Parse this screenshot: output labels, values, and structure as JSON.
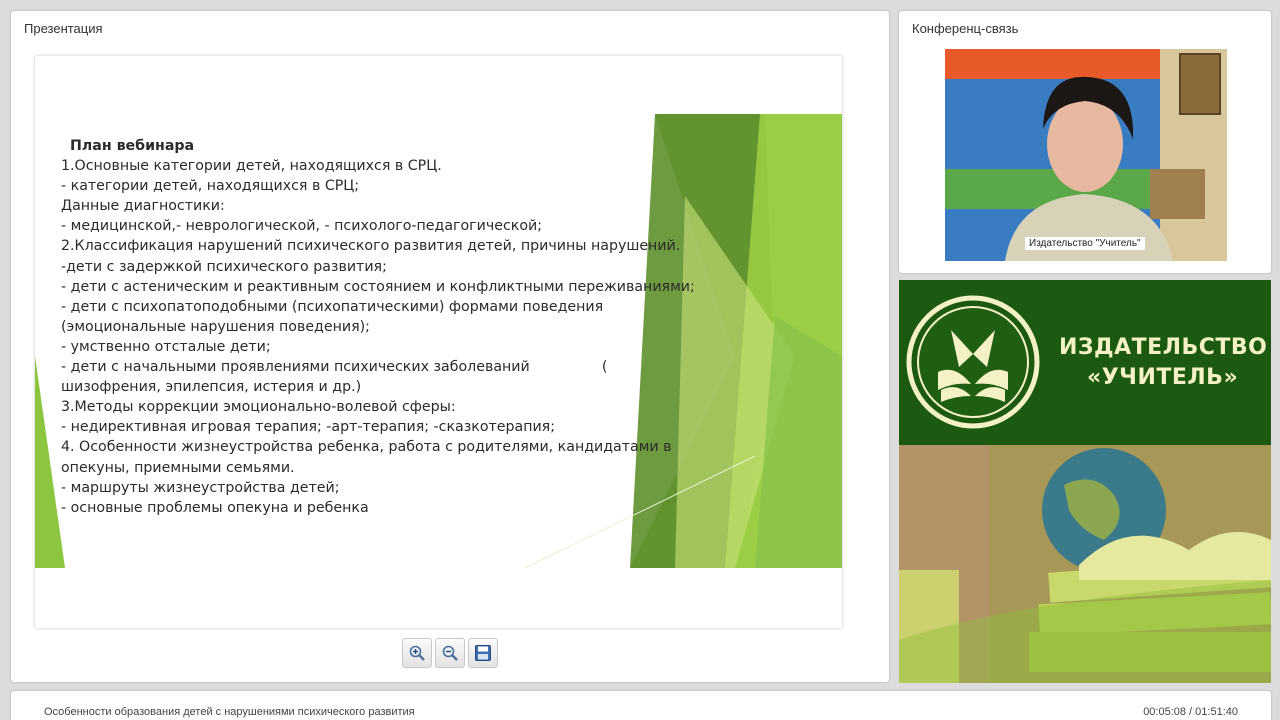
{
  "presentation": {
    "title": "Презентация",
    "slide": {
      "heading": "План вебинара",
      "lines": [
        "1.Основные категории детей, находящихся в СРЦ.",
        "- категории детей, находящихся в СРЦ;",
        "Данные диагностики:",
        "- медицинской,- неврологической, - психолого-педагогической;",
        " 2.Классификация нарушений психического развития детей, причины нарушений.",
        "-дети с задержкой психического развития;",
        "- дети с астеническим и реактивным состоянием и конфликтными переживаниями;",
        "- дети с психопатоподобными (психопатическими) формами поведения",
        "(эмоциональные нарушения поведения);",
        "- умственно отсталые дети;",
        "- дети с начальными проявлениями психических заболеваний                (",
        "шизофрения, эпилепсия, истерия и др.)",
        "3.Методы коррекции эмоционально-волевой сферы:",
        "- недирективная игровая терапия; -арт-терапия; -сказкотерапия;",
        "4. Особенности жизнеустройства ребенка, работа с родителями, кандидатами в",
        "опекуны, приемными семьями.",
        "- маршруты жизнеустройства детей;",
        "- основные проблемы опекуна и ребенка"
      ]
    },
    "toolbar": {
      "zoom_in_icon": "zoom-in-icon",
      "zoom_out_icon": "zoom-out-icon",
      "save_icon": "save-icon"
    }
  },
  "conference": {
    "title": "Конференц-связь",
    "video_label": "Издательство \"Учитель\""
  },
  "banner": {
    "name_line1": "ИЗДАТЕЛЬСТВО",
    "name_line2": "«УЧИТЕЛЬ»"
  },
  "footer": {
    "lecture_title": "Особенности образования детей с нарушениями психического развития",
    "time": "00:05:08 / 01:51:40"
  },
  "colors": {
    "slide_green_dark": "#5a8a2a",
    "slide_green_light": "#9acd32",
    "banner_green": "#1b5a10",
    "banner_text": "#f4f2c4"
  }
}
